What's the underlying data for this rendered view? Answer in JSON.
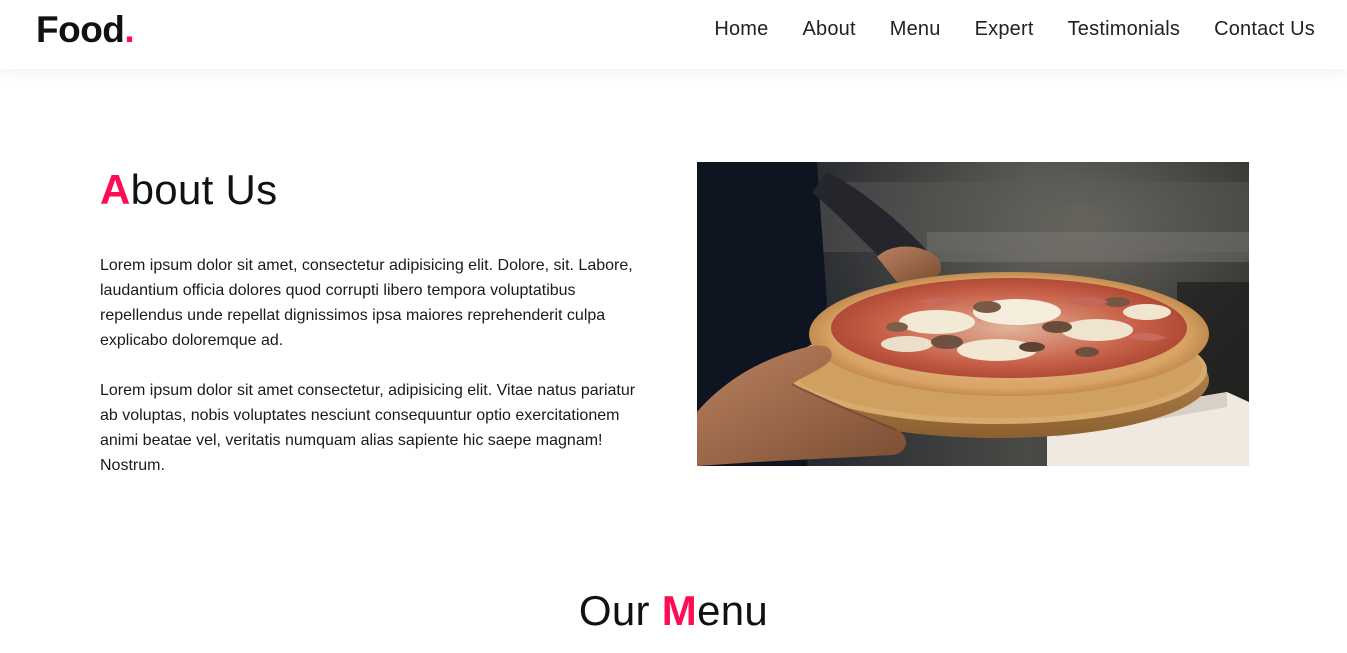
{
  "header": {
    "brand": {
      "name": "Food",
      "dot": "."
    },
    "nav": [
      {
        "label": "Home"
      },
      {
        "label": "About"
      },
      {
        "label": "Menu"
      },
      {
        "label": "Expert"
      },
      {
        "label": "Testimonials"
      },
      {
        "label": "Contact Us"
      }
    ]
  },
  "about": {
    "title_accent": "A",
    "title_rest": "bout Us",
    "paragraphs": [
      "Lorem ipsum dolor sit amet, consectetur adipisicing elit. Dolore, sit. Labore, laudantium officia dolores quod corrupti libero tempora voluptatibus repellendus unde repellat dignissimos ipsa maiores reprehenderit culpa explicabo doloremque ad.",
      "Lorem ipsum dolor sit amet consectetur, adipisicing elit. Vitae natus pariatur ab voluptas, nobis voluptates nesciunt consequuntur optio exercitationem animi beatae vel, veritatis numquam alias sapiente hic saepe magnam! Nostrum."
    ],
    "image": "pizza-photo"
  },
  "menu": {
    "title_before": "Our ",
    "title_accent": "M",
    "title_rest": "enu"
  },
  "colors": {
    "accent": "#ff0a54",
    "text": "#111111",
    "background": "#ffffff"
  }
}
